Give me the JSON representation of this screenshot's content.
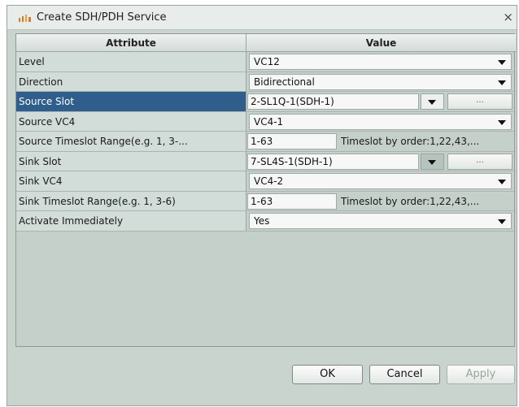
{
  "window": {
    "title": "Create SDH/PDH Service",
    "close_symbol": "×"
  },
  "table": {
    "header_attribute": "Attribute",
    "header_value": "Value",
    "rows": [
      {
        "attr": "Level",
        "value": "VC12"
      },
      {
        "attr": "Direction",
        "value": "Bidirectional"
      },
      {
        "attr": "Source Slot",
        "value": "2-SL1Q-1(SDH-1)",
        "button": "..."
      },
      {
        "attr": "Source VC4",
        "value": "VC4-1"
      },
      {
        "attr": "Source Timeslot Range(e.g. 1, 3-...",
        "value": "1-63",
        "order": "Timeslot by order:1,22,43,..."
      },
      {
        "attr": "Sink Slot",
        "value": "7-SL4S-1(SDH-1)",
        "button": "..."
      },
      {
        "attr": "Sink VC4",
        "value": "VC4-2"
      },
      {
        "attr": "Sink Timeslot Range(e.g. 1, 3-6)",
        "value": "1-63",
        "order": "Timeslot by order:1,22,43,..."
      },
      {
        "attr": "Activate Immediately",
        "value": "Yes"
      }
    ]
  },
  "buttons": {
    "ok": "OK",
    "cancel": "Cancel",
    "apply": "Apply"
  },
  "colors": {
    "selected_row": "#2f5d8c",
    "dialog_bg": "#c9d4cf"
  }
}
